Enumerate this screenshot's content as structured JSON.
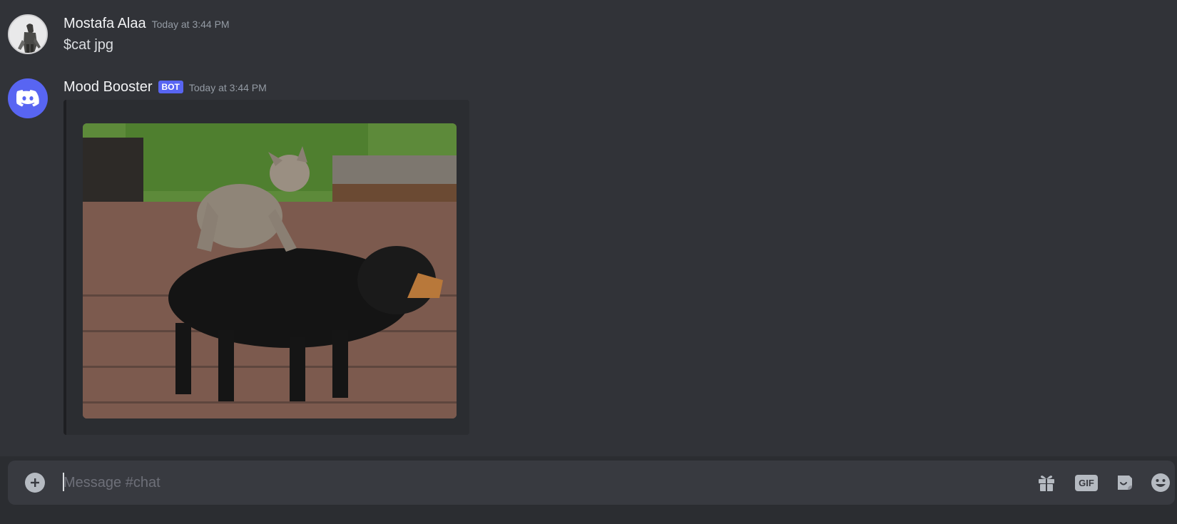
{
  "messages": [
    {
      "username": "Mostafa Alaa",
      "timestamp": "Today at 3:44 PM",
      "text": "$cat jpg"
    },
    {
      "username": "Mood Booster",
      "bot_tag": "BOT",
      "timestamp": "Today at 3:44 PM"
    }
  ],
  "composer": {
    "placeholder": "Message #chat",
    "gif_label": "GIF"
  },
  "colors": {
    "brand": "#5865f2",
    "chat_bg": "#313338",
    "composer_bg": "#383a40"
  }
}
